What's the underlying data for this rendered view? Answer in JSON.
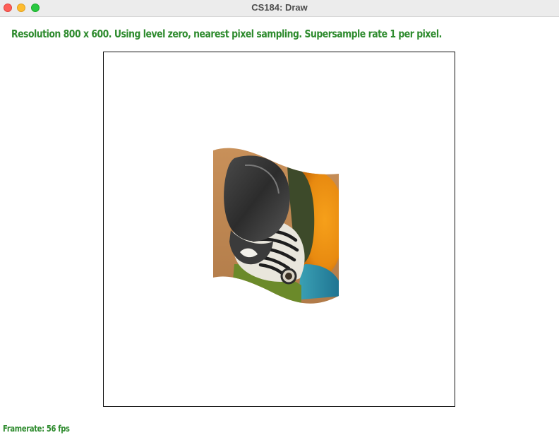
{
  "window": {
    "title": "CS184: Draw",
    "buttons": [
      "close",
      "minimize",
      "zoom"
    ]
  },
  "status_line": "Resolution 800 x 600. Using level zero, nearest pixel sampling. Supersample rate 1 per pixel.",
  "framerate": "Framerate: 56 fps",
  "colors": {
    "status_text": "#2e8b2e",
    "canvas_border": "#111111",
    "close": "#fe5f57",
    "minimize": "#febc2e",
    "zoom": "#28c840"
  },
  "canvas": {
    "image_subject": "macaw-parrot-head-texture"
  }
}
